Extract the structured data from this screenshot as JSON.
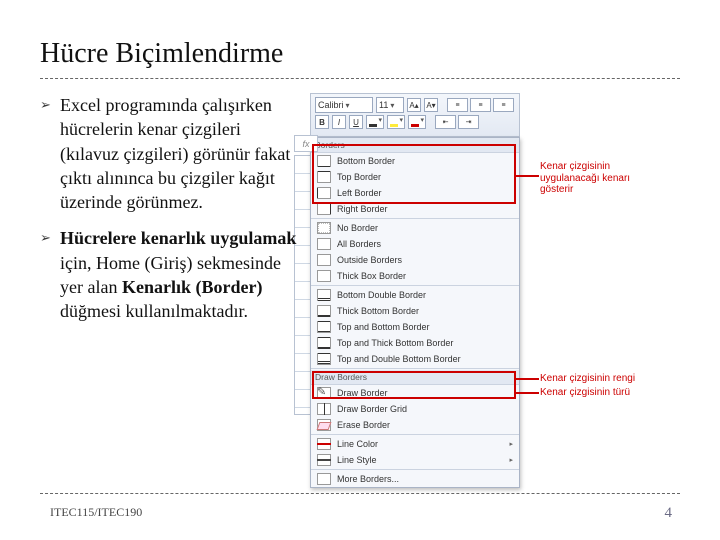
{
  "title": "Hücre Biçimlendirme",
  "bullets": [
    {
      "html": "Excel programında çalışırken hücrelerin kenar çizgileri (kılavuz çizgileri) görünür fakat çıktı alınınca bu çizgiler kağıt üzerinde görünmez."
    },
    {
      "html": "<span class='b'>Hücrelere kenarlık uygulamak</span> için, Home (Giriş) sekmesinde yer alan <span class='b'>Kenarlık (Border)</span> düğmesi kullanılmaktadır."
    }
  ],
  "ribbon": {
    "font": "Calibri",
    "size": "11",
    "bold": "B",
    "italic": "I",
    "underline": "U"
  },
  "dropdown": {
    "borders_hdr": "Borders",
    "draw_hdr": "Draw Borders",
    "items": [
      {
        "key": "bb",
        "label": "Bottom Border"
      },
      {
        "key": "tb",
        "label": "Top Border"
      },
      {
        "key": "lb",
        "label": "Left Border"
      },
      {
        "key": "rb",
        "label": "Right Border"
      },
      {
        "key": "nb",
        "label": "No Border"
      },
      {
        "key": "ab",
        "label": "All Borders"
      },
      {
        "key": "ob",
        "label": "Outside Borders"
      },
      {
        "key": "tkb",
        "label": "Thick Box Border"
      },
      {
        "key": "bdb",
        "label": "Bottom Double Border"
      },
      {
        "key": "thb",
        "label": "Thick Bottom Border"
      },
      {
        "key": "tbb",
        "label": "Top and Bottom Border"
      },
      {
        "key": "tbtk",
        "label": "Top and Thick Bottom Border"
      },
      {
        "key": "tbdb",
        "label": "Top and Double Bottom Border"
      }
    ],
    "draw_items": [
      {
        "key": "pen",
        "label": "Draw Border"
      },
      {
        "key": "grid",
        "label": "Draw Border Grid"
      },
      {
        "key": "erase",
        "label": "Erase Border"
      },
      {
        "key": "lc",
        "label": "Line Color",
        "sub": true
      },
      {
        "key": "ls",
        "label": "Line Style",
        "sub": true
      },
      {
        "key": "more",
        "label": "More Borders..."
      }
    ]
  },
  "annotations": {
    "edge": "Kenar çizgisinin uygulanacağı kenarı gösterir",
    "color": "Kenar çizgisinin rengi",
    "style": "Kenar çizgisinin türü"
  },
  "footer": "ITEC115/ITEC190",
  "page": "4"
}
